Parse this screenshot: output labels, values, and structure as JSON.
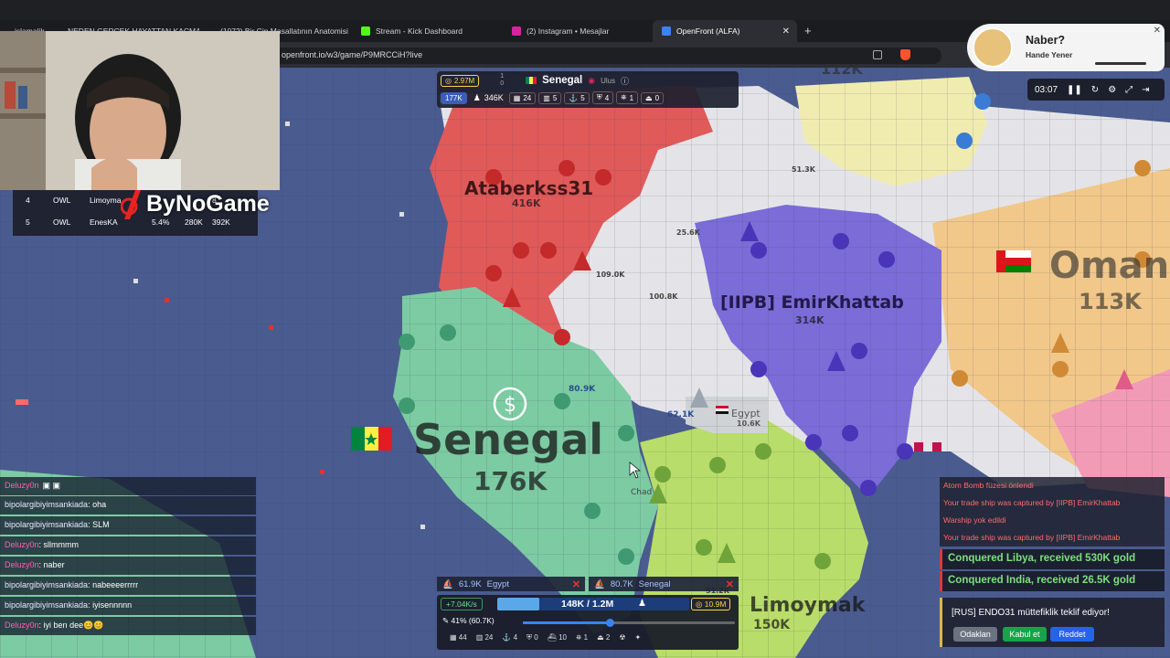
{
  "browser": {
    "tabs": [
      {
        "label": "islamalik",
        "color": "#e0245e"
      },
      {
        "label": "NEDEN GERÇEK HAYATTAN KAÇMAK",
        "color": "#ff0000"
      },
      {
        "label": "(1072) Bir Çin Masallatının Anatomisi",
        "color": "#ff0000"
      },
      {
        "label": "Stream - Kick Dashboard",
        "color": "#53fc18"
      },
      {
        "label": "(2) Instagram • Mesajlar",
        "color": "#d6249f"
      },
      {
        "label": "OpenFront (ALFA)",
        "color": "#3b82f6"
      }
    ],
    "new_tab": "+",
    "address": "openfront.io/w3/game/P9MRCCiH?live"
  },
  "hud_top": {
    "gold": "2.97M",
    "ratio_top": "1",
    "ratio_bottom": "0",
    "player_name": "Senegal",
    "team": "Ulus",
    "troops": "177K",
    "max_troops": "346K",
    "buildings": [
      "24",
      "5",
      "5",
      "4",
      "1",
      "0"
    ]
  },
  "player_list": [
    {
      "rank": "4",
      "team": "OWL",
      "name": "Limoyma",
      "pct": "",
      "troops": "",
      "max": "8"
    },
    {
      "rank": "5",
      "team": "OWL",
      "name": "EnesKA",
      "pct": "5.4%",
      "troops": "280K",
      "max": "392K"
    }
  ],
  "watermark": "ByNoGame",
  "music": {
    "title": "Naber?",
    "artist": "Hande Yener",
    "time": "03:07"
  },
  "map_labels": {
    "senegal": "Senegal",
    "senegal_troops": "176K",
    "ataberk": "Ataberkss31",
    "ataberk_troops": "416K",
    "emir": "[IIPB] EmirKhattab",
    "emir_troops": "314K",
    "oman": "Oman",
    "oman_troops": "113K",
    "egypt": "Egypt",
    "egypt_troops": "10.6K",
    "limoymak": "Limoymak",
    "limoymak_troops": "150K",
    "chad": "Chad",
    "top_troops": "112K",
    "n1": "80.9K",
    "n2": "62.1K",
    "n3": "109.0K",
    "n4": "100.8K",
    "n5": "51.2K",
    "n6": "51.3K",
    "n7": "25.6K"
  },
  "chat": [
    {
      "user": "Deluzy0n",
      "text": "",
      "pink": true
    },
    {
      "user": "bipolargibiyimsankiada",
      "text": "oha",
      "pink": false
    },
    {
      "user": "bipolargibiyimsankiada",
      "text": "SLM",
      "pink": false
    },
    {
      "user": "Deluzy0n",
      "text": "sllmmmm",
      "pink": true
    },
    {
      "user": "Deluzy0n",
      "text": "naber",
      "pink": true
    },
    {
      "user": "bipolargibiyimsankiada",
      "text": "nabeeeerrrrr",
      "pink": false
    },
    {
      "user": "bipolargibiyimsankiada",
      "text": "iyisennnnn",
      "pink": false
    },
    {
      "user": "Deluzy0n",
      "text": "iyi ben dee😊😊",
      "pink": true
    }
  ],
  "events": [
    "Atom Bomb füzesi önlendi",
    "Your trade ship was captured by [IIPB] EmirKhattab",
    "Warship yok edildi",
    "Your trade ship was captured by [IIPB] EmirKhattab"
  ],
  "conquests": [
    "Conquered Libya, received 530K gold",
    "Conquered India, received 26.5K gold"
  ],
  "alliance": {
    "message": "[RUS] ENDO31 müttefiklik teklif ediyor!",
    "focus": "Odaklan",
    "accept": "Kabul et",
    "reject": "Reddet"
  },
  "attacks": [
    {
      "troops": "61.9K",
      "target": "Egypt"
    },
    {
      "troops": "80.7K",
      "target": "Senegal"
    }
  ],
  "hud_bottom": {
    "rate": "+7.04K/s",
    "troops": "148K / 1.2M",
    "gold": "10.9M",
    "ratio": "41% (60.7K)",
    "ratio_fraction": 0.41,
    "units": [
      "44",
      "24",
      "4",
      "0",
      "10",
      "1",
      "2"
    ]
  },
  "colors": {
    "ocean": "#4a5b8f",
    "senegal": "#7ccba3",
    "ataberk": "#e05a5a",
    "emir": "#7b6cd8",
    "limoymak": "#b9dd6a",
    "oman": "#f1c88a",
    "neutral": "#e4e4e8",
    "yellowland": "#f0ecb0"
  }
}
